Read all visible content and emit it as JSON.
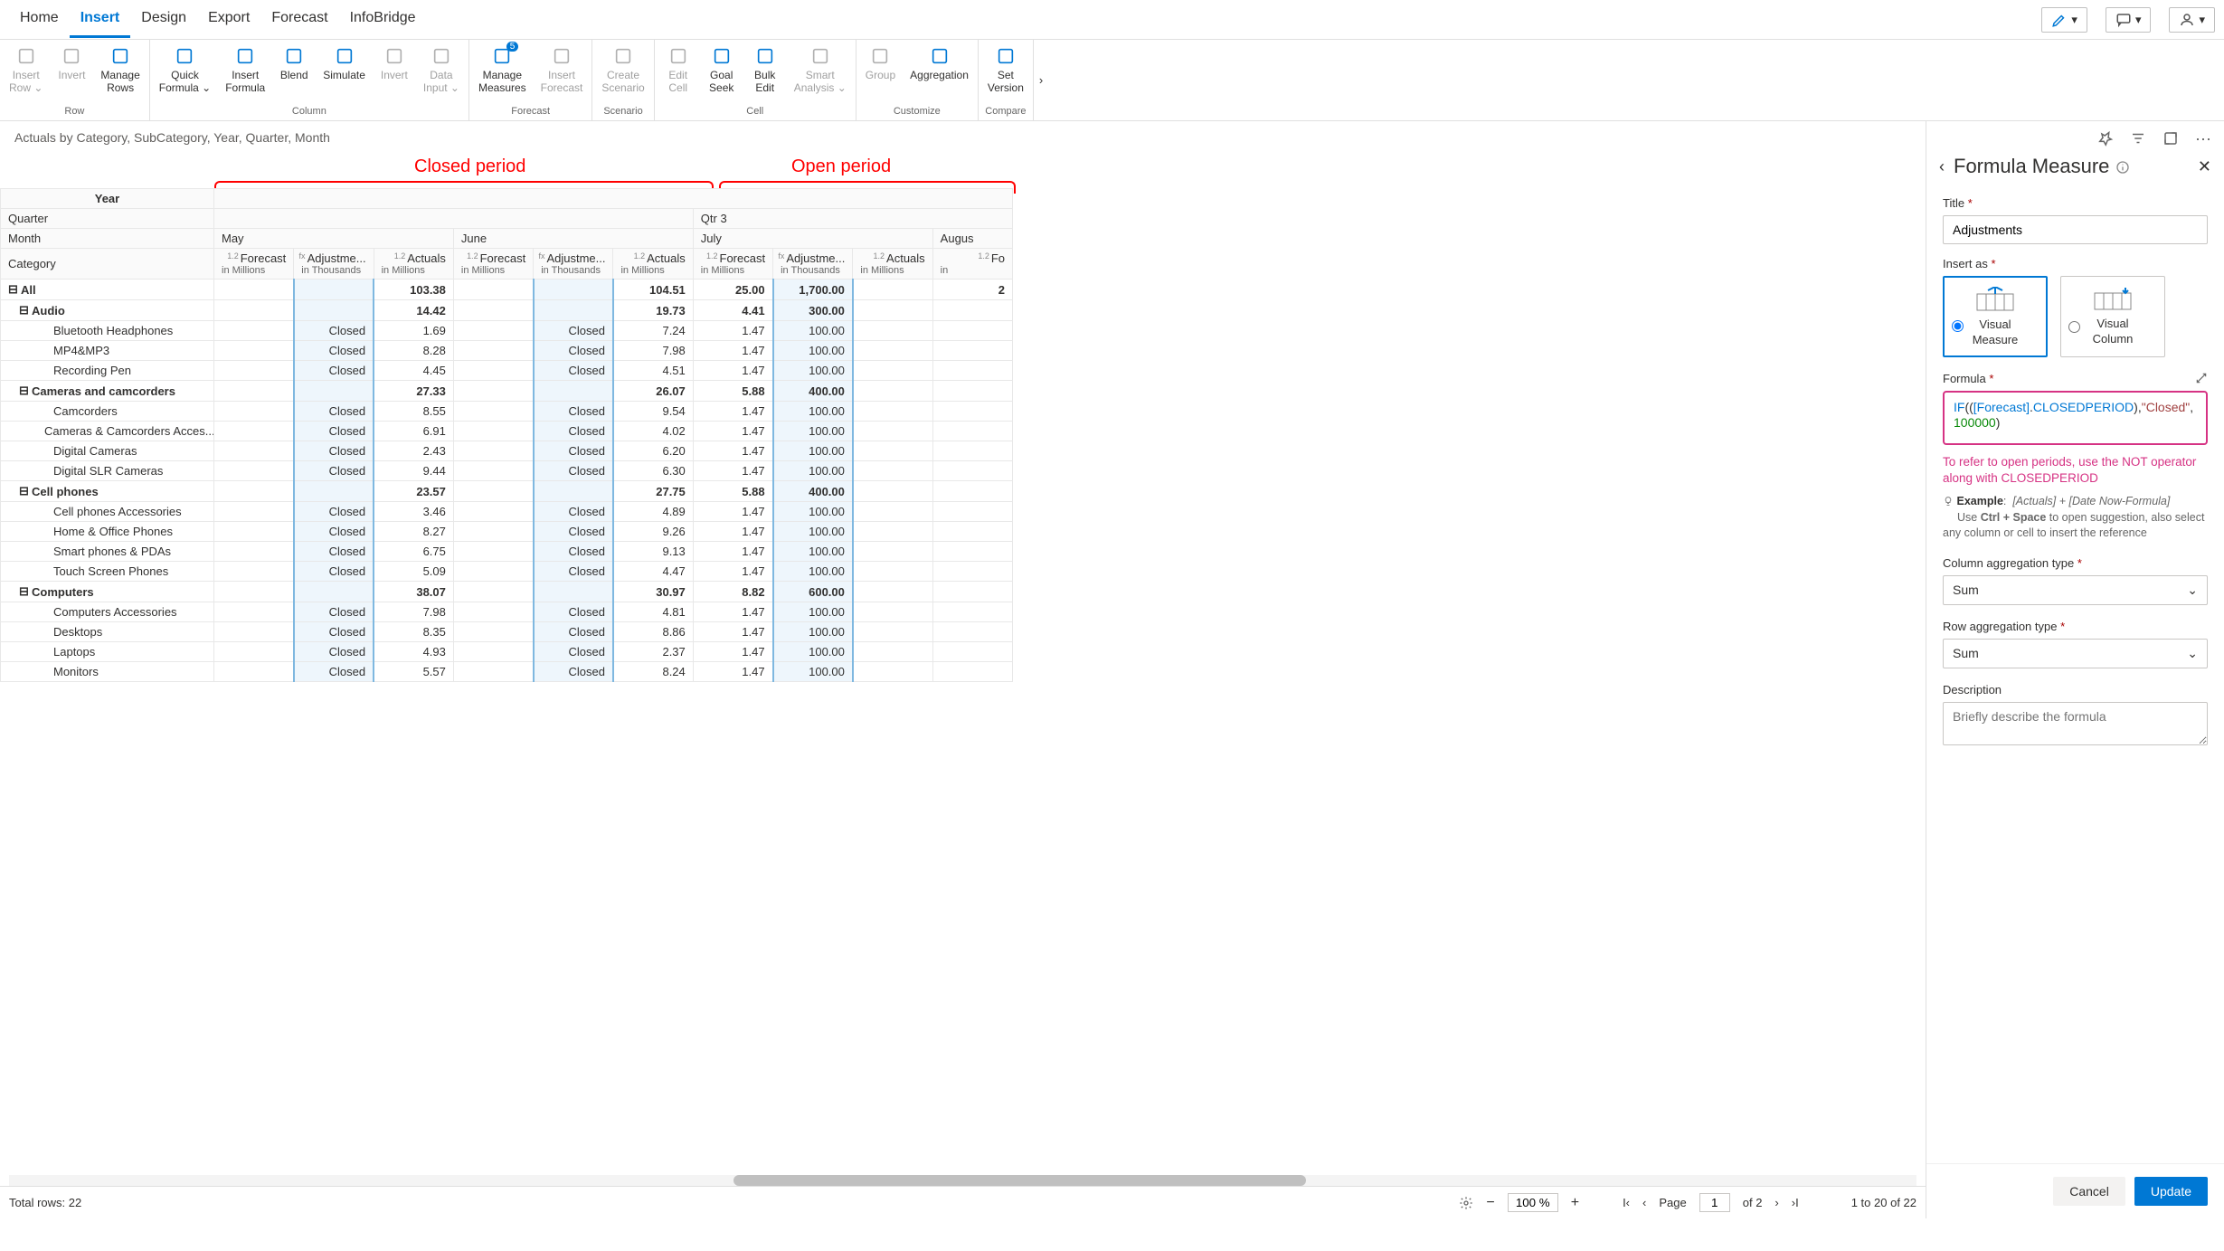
{
  "tabs": [
    "Home",
    "Insert",
    "Design",
    "Export",
    "Forecast",
    "InfoBridge"
  ],
  "activeTab": 1,
  "ribbon": {
    "groups": [
      {
        "name": "Row",
        "items": [
          {
            "label": "Insert\nRow",
            "disabled": true,
            "chev": true
          },
          {
            "label": "Invert",
            "disabled": true
          },
          {
            "label": "Manage\nRows"
          }
        ]
      },
      {
        "name": "Column",
        "items": [
          {
            "label": "Quick\nFormula",
            "chev": true
          },
          {
            "label": "Insert\nFormula"
          },
          {
            "label": "Blend"
          },
          {
            "label": "Simulate"
          },
          {
            "label": "Invert",
            "disabled": true
          },
          {
            "label": "Data\nInput",
            "disabled": true,
            "chev": true
          }
        ]
      },
      {
        "name": "Forecast",
        "items": [
          {
            "label": "Manage\nMeasures",
            "badge": "5"
          },
          {
            "label": "Insert\nForecast",
            "disabled": true
          }
        ]
      },
      {
        "name": "Scenario",
        "items": [
          {
            "label": "Create\nScenario",
            "disabled": true
          }
        ]
      },
      {
        "name": "Cell",
        "items": [
          {
            "label": "Edit\nCell",
            "disabled": true
          },
          {
            "label": "Goal\nSeek"
          },
          {
            "label": "Bulk\nEdit"
          },
          {
            "label": "Smart\nAnalysis",
            "disabled": true,
            "chev": true
          }
        ]
      },
      {
        "name": "Customize",
        "items": [
          {
            "label": "Group",
            "disabled": true
          },
          {
            "label": "Aggregation"
          }
        ]
      },
      {
        "name": "Compare",
        "items": [
          {
            "label": "Set\nVersion"
          }
        ]
      }
    ]
  },
  "breadcrumb": "Actuals by Category, SubCategory, Year, Quarter, Month",
  "annot": {
    "closed": "Closed period",
    "open": "Open period"
  },
  "grid": {
    "cornerYear": "Year",
    "cornerQuarter": "Quarter",
    "cornerMonth": "Month",
    "cornerCategory": "Category",
    "qtr3": "Qtr 3",
    "months": [
      "May",
      "June",
      "July",
      "Augus"
    ],
    "colset": [
      {
        "t": "Forecast",
        "s": "in Millions"
      },
      {
        "t": "Adjustme...",
        "s": "in Thousands",
        "adj": true,
        "fx": true
      },
      {
        "t": "Actuals",
        "s": "in Millions"
      }
    ],
    "lastcol": {
      "t": "Fo",
      "s": "in "
    },
    "rows": [
      {
        "lvl": 0,
        "exp": "⊟",
        "label": "All",
        "bold": true,
        "vals": [
          "",
          "",
          "103.38",
          "",
          "",
          "104.51",
          "25.00",
          "1,700.00",
          "",
          "2"
        ]
      },
      {
        "lvl": 1,
        "exp": "⊟",
        "label": "Audio",
        "bold": true,
        "vals": [
          "",
          "",
          "14.42",
          "",
          "",
          "19.73",
          "4.41",
          "300.00",
          "",
          ""
        ]
      },
      {
        "lvl": 2,
        "label": "Bluetooth Headphones",
        "vals": [
          "",
          "Closed",
          "1.69",
          "",
          "Closed",
          "7.24",
          "1.47",
          "100.00",
          "",
          ""
        ]
      },
      {
        "lvl": 2,
        "label": "MP4&MP3",
        "vals": [
          "",
          "Closed",
          "8.28",
          "",
          "Closed",
          "7.98",
          "1.47",
          "100.00",
          "",
          ""
        ]
      },
      {
        "lvl": 2,
        "label": "Recording Pen",
        "vals": [
          "",
          "Closed",
          "4.45",
          "",
          "Closed",
          "4.51",
          "1.47",
          "100.00",
          "",
          ""
        ]
      },
      {
        "lvl": 1,
        "exp": "⊟",
        "label": "Cameras and camcorders",
        "bold": true,
        "vals": [
          "",
          "",
          "27.33",
          "",
          "",
          "26.07",
          "5.88",
          "400.00",
          "",
          ""
        ]
      },
      {
        "lvl": 2,
        "label": "Camcorders",
        "vals": [
          "",
          "Closed",
          "8.55",
          "",
          "Closed",
          "9.54",
          "1.47",
          "100.00",
          "",
          ""
        ]
      },
      {
        "lvl": 2,
        "label": "Cameras & Camcorders Acces...",
        "vals": [
          "",
          "Closed",
          "6.91",
          "",
          "Closed",
          "4.02",
          "1.47",
          "100.00",
          "",
          ""
        ]
      },
      {
        "lvl": 2,
        "label": "Digital Cameras",
        "vals": [
          "",
          "Closed",
          "2.43",
          "",
          "Closed",
          "6.20",
          "1.47",
          "100.00",
          "",
          ""
        ]
      },
      {
        "lvl": 2,
        "label": "Digital SLR Cameras",
        "vals": [
          "",
          "Closed",
          "9.44",
          "",
          "Closed",
          "6.30",
          "1.47",
          "100.00",
          "",
          ""
        ]
      },
      {
        "lvl": 1,
        "exp": "⊟",
        "label": "Cell phones",
        "bold": true,
        "vals": [
          "",
          "",
          "23.57",
          "",
          "",
          "27.75",
          "5.88",
          "400.00",
          "",
          ""
        ]
      },
      {
        "lvl": 2,
        "label": "Cell phones Accessories",
        "vals": [
          "",
          "Closed",
          "3.46",
          "",
          "Closed",
          "4.89",
          "1.47",
          "100.00",
          "",
          ""
        ]
      },
      {
        "lvl": 2,
        "label": "Home & Office Phones",
        "vals": [
          "",
          "Closed",
          "8.27",
          "",
          "Closed",
          "9.26",
          "1.47",
          "100.00",
          "",
          ""
        ]
      },
      {
        "lvl": 2,
        "label": "Smart phones & PDAs",
        "vals": [
          "",
          "Closed",
          "6.75",
          "",
          "Closed",
          "9.13",
          "1.47",
          "100.00",
          "",
          ""
        ]
      },
      {
        "lvl": 2,
        "label": "Touch Screen Phones",
        "vals": [
          "",
          "Closed",
          "5.09",
          "",
          "Closed",
          "4.47",
          "1.47",
          "100.00",
          "",
          ""
        ]
      },
      {
        "lvl": 1,
        "exp": "⊟",
        "label": "Computers",
        "bold": true,
        "vals": [
          "",
          "",
          "38.07",
          "",
          "",
          "30.97",
          "8.82",
          "600.00",
          "",
          ""
        ]
      },
      {
        "lvl": 2,
        "label": "Computers Accessories",
        "vals": [
          "",
          "Closed",
          "7.98",
          "",
          "Closed",
          "4.81",
          "1.47",
          "100.00",
          "",
          ""
        ]
      },
      {
        "lvl": 2,
        "label": "Desktops",
        "vals": [
          "",
          "Closed",
          "8.35",
          "",
          "Closed",
          "8.86",
          "1.47",
          "100.00",
          "",
          ""
        ]
      },
      {
        "lvl": 2,
        "label": "Laptops",
        "vals": [
          "",
          "Closed",
          "4.93",
          "",
          "Closed",
          "2.37",
          "1.47",
          "100.00",
          "",
          ""
        ]
      },
      {
        "lvl": 2,
        "label": "Monitors",
        "vals": [
          "",
          "Closed",
          "5.57",
          "",
          "Closed",
          "8.24",
          "1.47",
          "100.00",
          "",
          ""
        ]
      }
    ]
  },
  "panel": {
    "title": "Formula Measure",
    "titleLabel": "Title",
    "titleValue": "Adjustments",
    "insertAs": "Insert as",
    "optMeasure": "Visual\nMeasure",
    "optColumn": "Visual\nColumn",
    "formulaLabel": "Formula",
    "formula": {
      "fn": "IF",
      "open": "((",
      "ref": "[Forecast]",
      "dot": ".",
      "prop": "CLOSEDPERIOD",
      "mid": "),",
      "str": "\"Closed\"",
      "comma": ",",
      "num": "100000",
      "close": ")"
    },
    "note": "To refer to open periods, use the NOT operator along with CLOSEDPERIOD",
    "hintLabel": "Example",
    "hintEx": "[Actuals] + [Date Now-Formula]",
    "hint2a": "Use ",
    "hint2b": "Ctrl + Space",
    "hint2c": " to open suggestion, also select any column or cell to insert the reference",
    "colAggLabel": "Column aggregation type",
    "colAggVal": "Sum",
    "rowAggLabel": "Row aggregation type",
    "rowAggVal": "Sum",
    "descLabel": "Description",
    "descPH": "Briefly describe the formula",
    "cancel": "Cancel",
    "update": "Update"
  },
  "status": {
    "total": "Total rows: 22",
    "zoom": "100 %",
    "pageLabel": "Page",
    "page": "1",
    "pageOf": "of 2",
    "range": "1  to  20  of  22"
  }
}
